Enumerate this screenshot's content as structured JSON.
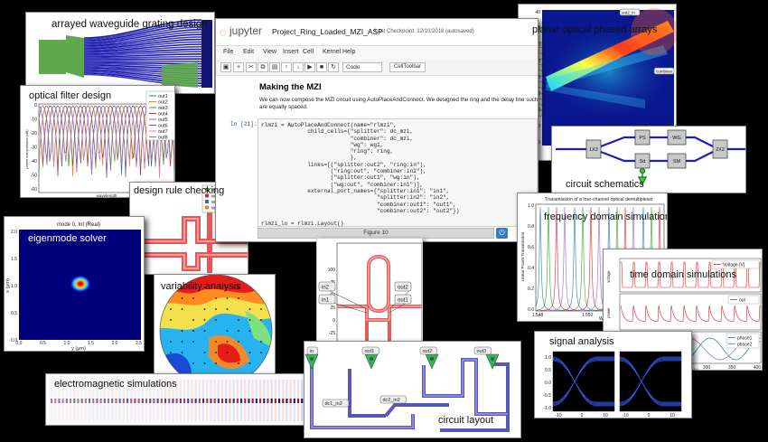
{
  "labels": {
    "awg": "arrayed waveguide grating design",
    "filter": "optical filter design",
    "drc": "design rule checking",
    "eigen": "eigenmode solver",
    "variability": "variability analysis",
    "em": "electromagnetic simulations",
    "layout": "circuit layout",
    "opa": "planar optical phased arrays",
    "schematics": "circuit schematics",
    "freq": "frequency domain simulations",
    "time": "time domain simulations",
    "signal": "signal analysis"
  },
  "jupyter": {
    "logo": "jupyter",
    "notebook_name": "Project_Ring_Loaded_MZI_ASP",
    "checkpoint": "Last Checkpoint: 12/10/2018 (autosaved)",
    "menu": [
      "File",
      "Edit",
      "View",
      "Insert",
      "Cell",
      "Kernel",
      "Help"
    ],
    "cell_type": "Code",
    "celltoolbar": "CellToolbar",
    "heading": "Making the MZI",
    "paragraph_1": "We can now compose the MZI circuit using AutoPlaceAndConnect. We designed the ring and the delay line such",
    "paragraph_2": "are equally spaced.",
    "prompt": "In [21]:",
    "code_lines": [
      "rlmzi = AutoPlaceAndConnect(name=\"rlmzi\",",
      "              child_cells={\"splitter\": dc_mzi,",
      "                           \"combiner\": dc_mzi,",
      "                           \"wg\": wg1,",
      "                           \"ring\": ring,",
      "                           },",
      "              links=[(\"splitter:out2\", \"ring:in\"),",
      "                     (\"ring:out\", \"combiner:in2\"),",
      "                     (\"splitter:out1\", \"wg:in\"),",
      "                     (\"wg:out\", \"combiner:in1\")],",
      "              external_port_names={\"splitter:in1\": \"in1\",",
      "                                   \"splitter:in2\": \"in2\",",
      "                                   \"combiner:out1\": \"out1\",",
      "                                   \"combiner:out2\": \"out2\"})",
      "",
      "rlmzi_lo = rlmzi.Layout()",
      "rlmzi_lo.visualize(annotate=True)"
    ],
    "figure_title": "Figure 10"
  },
  "filter_plot": {
    "ylabel": "power transmission (dB)",
    "xlabel": "wavelength",
    "legend": [
      "out1",
      "out2",
      "out3",
      "out4",
      "out5",
      "out6",
      "out7",
      "out8"
    ],
    "yticks": [
      "0",
      "-10",
      "-20",
      "-30",
      "-40",
      "-50",
      "-60"
    ],
    "colors": [
      "#1f77b4",
      "#ff7f0e",
      "#2ca02c",
      "#d62728",
      "#9467bd",
      "#8c564b",
      "#e377c2",
      "#7f7f7f"
    ]
  },
  "drc_legend": [
    "WG.W.155",
    "WG.W0.060",
    "WG.SHARPANGLE",
    "WG.LR.W.10"
  ],
  "eigen_plot": {
    "title": "mode 0, Int (Real)",
    "xlabel": "y (μm)",
    "ylabel": "x (μm)",
    "xticks": [
      "0.0",
      "0.5",
      "1.0",
      "1.5",
      "2.0",
      "2.5"
    ],
    "yticks": [
      "2.0",
      "1.5",
      "1.0",
      "0.5",
      "0.0"
    ]
  },
  "mzi_ports": [
    "in2",
    "in1",
    "out2",
    "out1"
  ],
  "mzi_yticks": [
    "100",
    "75",
    "50",
    "25",
    "0",
    "-25",
    "-50",
    "-75"
  ],
  "layout_ports": [
    "in",
    "out1",
    "out2",
    "out3",
    "dc1_in2",
    "dc2_in2"
  ],
  "opa_ports": [
    "out2_in",
    "ap1_in",
    "ap2_in",
    "ap3_in",
    "ap4_in",
    "ap5_in",
    "ap6_in",
    "ap7_in",
    "ap8_in",
    "ap9_in",
    "ap10_in",
    "ap11_in",
    "ap12_in",
    "ap13_in",
    "combiner"
  ],
  "opa_yticks": [
    "40",
    "30",
    "20",
    "10",
    "0",
    "-10",
    "-20",
    "-30",
    "-40"
  ],
  "schematic_blocks": [
    "1X2",
    "PS",
    "WG",
    "Sd",
    "SM",
    "2X2"
  ],
  "freq_plot": {
    "title": "Transmission of a four-channel optical demultiplexer",
    "ylabel": "Linear Power Transmission",
    "xticks": [
      "1.548",
      "1.550",
      "1.552"
    ],
    "yticks": [
      "1.0",
      "0.8",
      "0.6",
      "0.4",
      "0.2",
      "0.0"
    ],
    "xlabel": "Wave"
  },
  "time_plot": {
    "legend_voltage": "Voltage [V]",
    "legend_out": "out",
    "legend_phase1": "phase1",
    "legend_phase2": "phase2",
    "xticks": [
      "150",
      "200",
      "250",
      "300",
      "350",
      "400"
    ],
    "xlabel": "[s]",
    "ylabel_top": "voltage",
    "ylabel_mid": "power"
  },
  "signal_plot": {
    "yticks": [
      "1.0",
      "0.5",
      "0.0",
      "-0.5",
      "-1.0"
    ],
    "xticks": [
      "-10",
      "0",
      "10"
    ]
  }
}
